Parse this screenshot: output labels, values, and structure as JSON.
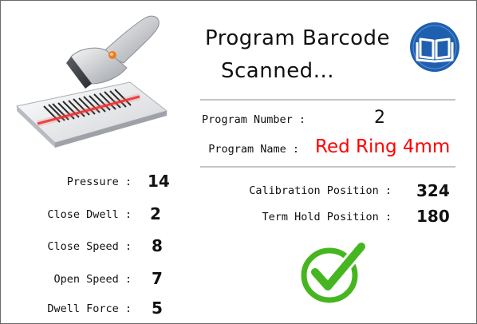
{
  "header": {
    "title_line1": "Program Barcode",
    "title_line2": "Scanned..."
  },
  "program": {
    "number_label": "Program Number :",
    "number_value": "2",
    "name_label": "Program Name :",
    "name_value": "Red Ring 4mm",
    "name_color": "#ff0000"
  },
  "params": [
    {
      "label": "Pressure :",
      "value": "14"
    },
    {
      "label": "Close Dwell :",
      "value": "2"
    },
    {
      "label": "Close Speed :",
      "value": "8"
    },
    {
      "label": "Open Speed :",
      "value": "7"
    },
    {
      "label": "Dwell Force :",
      "value": "5"
    }
  ],
  "positions": [
    {
      "label": "Calibration Position :",
      "value": "324"
    },
    {
      "label": "Term Hold Position :",
      "value": "180"
    }
  ],
  "icons": {
    "scanner": "barcode-scanner-icon",
    "manual": "manual-book-icon",
    "status": "success-checkmark-icon"
  },
  "colors": {
    "manual_badge": "#1f5fb0",
    "check": "#46b620"
  }
}
